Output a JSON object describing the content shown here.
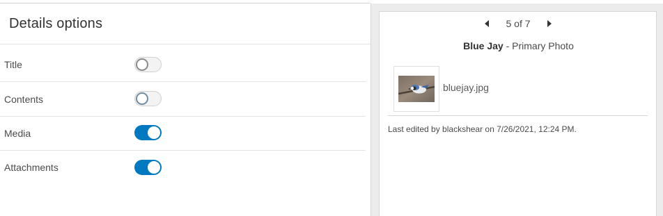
{
  "panel": {
    "title": "Details options"
  },
  "options": [
    {
      "label": "Title",
      "state": "off"
    },
    {
      "label": "Contents",
      "state": "off"
    },
    {
      "label": "Media",
      "state": "on"
    },
    {
      "label": "Attachments",
      "state": "on"
    }
  ],
  "popup": {
    "pager": {
      "text": "5 of 7"
    },
    "feature_name": "Blue Jay",
    "feature_subtitle": " - Primary Photo",
    "attachment": {
      "filename": "bluejay.jpg"
    },
    "last_edited": "Last edited by blackshear on 7/26/2021, 12:24 PM."
  },
  "colors": {
    "accent": "#0079c1",
    "toggle_off_track": "#f3f3f3"
  },
  "icons": {
    "prev": "caret-left-icon",
    "next": "caret-right-icon"
  }
}
